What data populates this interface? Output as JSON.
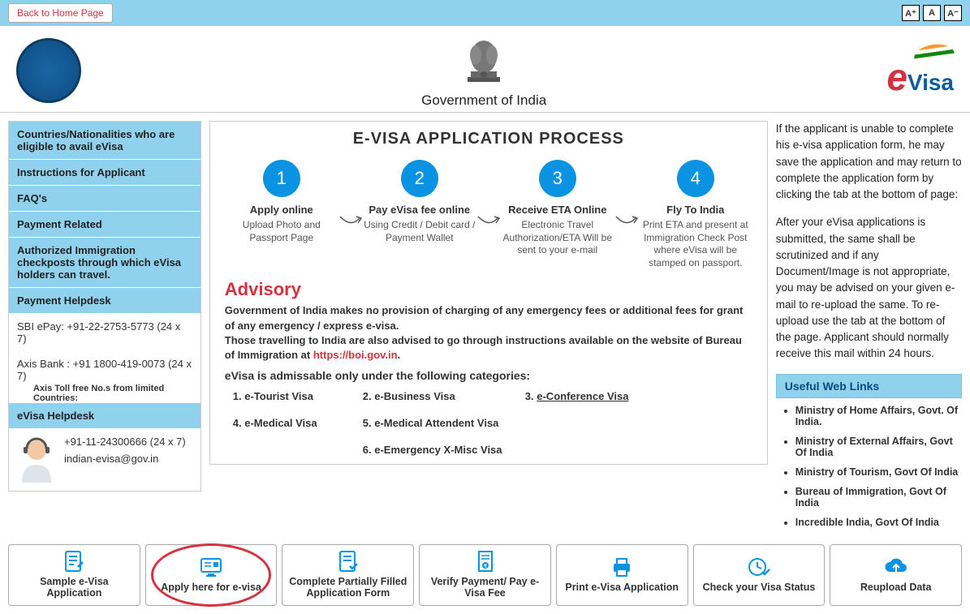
{
  "topbar": {
    "back_label": "Back to Home Page",
    "font_plus": "A⁺",
    "font_norm": "A",
    "font_minus": "A⁻"
  },
  "header": {
    "gov_text": "Government of India"
  },
  "sidebar": {
    "items": [
      "Countries/Nationalities who are eligible to avail eVisa",
      "Instructions for Applicant",
      "FAQ's",
      "Payment Related",
      "Authorized Immigration checkposts through which eVisa holders can travel.",
      "Payment Helpdesk"
    ],
    "sbi": "SBI ePay: +91-22-2753-5773 (24 x 7)",
    "axis": "Axis Bank : +91 1800-419-0073 (24 x 7)",
    "axis_note": "Axis Toll free No.s from limited Countries:",
    "evisa_help_head": "eVisa Helpdesk",
    "evisa_phone": "+91-11-24300666 (24 x 7)",
    "evisa_email": "indian-evisa@gov.in"
  },
  "main": {
    "title": "E-VISA APPLICATION PROCESS",
    "steps": [
      {
        "n": "1",
        "title": "Apply online",
        "desc": "Upload Photo and Passport Page"
      },
      {
        "n": "2",
        "title": "Pay eVisa fee online",
        "desc": "Using Credit / Debit card / Payment Wallet"
      },
      {
        "n": "3",
        "title": "Receive ETA Online",
        "desc": "Electronic Travel Authorization/ETA Will be sent to your e-mail"
      },
      {
        "n": "4",
        "title": "Fly To India",
        "desc": "Print ETA and present at Immigration Check Post where eVisa will be stamped on passport."
      }
    ],
    "advisory_h": "Advisory",
    "advisory_p1a": "Government of India makes no provision of charging of any emergency fees or additional fees for grant of any emergency / express e-visa.",
    "advisory_p1b": "Those travelling to India are also advised to go through instructions available on the website of Bureau of Immigration at ",
    "advisory_link": "https://boi.gov.in",
    "advisory_dot": ".",
    "cat_h": "eVisa is admissable only under the following categories:",
    "cats": {
      "c1": "1.   e-Tourist Visa",
      "c2": "2.   e-Business Visa",
      "c3": "3.   ",
      "c3b": "e-Conference Visa",
      "c4": "4.   e-Medical Visa",
      "c5": "5.   e-Medical Attendent Visa",
      "c6": "6.   e-Emergency X-Misc Visa"
    }
  },
  "rightbar": {
    "p1": "If the applicant is unable to complete his e-visa application form, he may save the application and may return to complete the application form by clicking the tab at the bottom of page:",
    "p2": "After your eVisa applications is submitted, the same shall be scrutinized and if any Document/Image is not appropriate, you may be advised on your given e-mail to re-upload the same. To re-upload use the tab at the bottom of the page. Applicant should normally receive this mail within 24 hours.",
    "links_h": "Useful Web Links",
    "links": [
      "Ministry of Home Affairs, Govt. Of India.",
      "Ministry of External Affairs, Govt Of India",
      "Ministry of Tourism, Govt Of India",
      "Bureau of Immigration, Govt Of India",
      "Incredible India, Govt Of India"
    ]
  },
  "tabs": [
    "Sample e-Visa Application",
    "Apply here for e-visa",
    "Complete Partially Filled Application Form",
    "Verify Payment/ Pay e-Visa Fee",
    "Print e-Visa Application",
    "Check your Visa Status",
    "Reupload Data"
  ]
}
